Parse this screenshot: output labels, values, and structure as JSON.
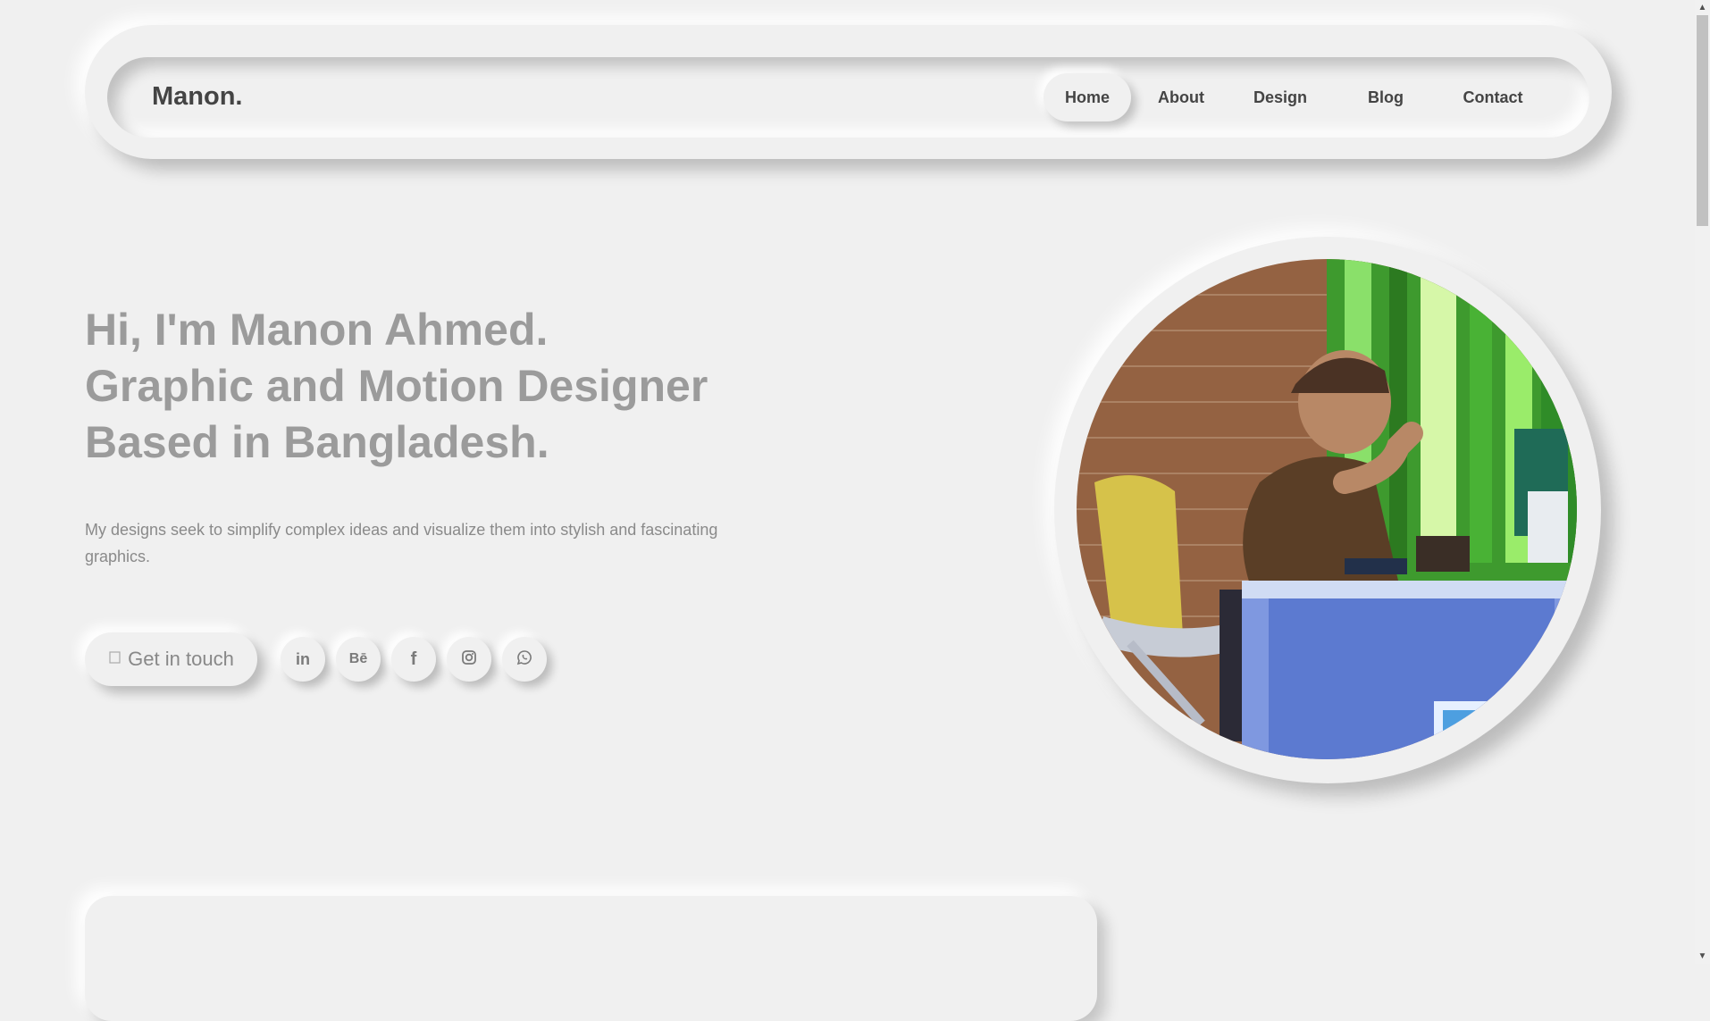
{
  "nav": {
    "logo": "Manon.",
    "links": [
      {
        "label": "Home",
        "active": true
      },
      {
        "label": "About",
        "active": false
      },
      {
        "label": "Design",
        "active": false
      },
      {
        "label": "Blog",
        "active": false
      },
      {
        "label": "Contact",
        "active": false
      }
    ]
  },
  "hero": {
    "title_lines": [
      "Hi, I'm Manon Ahmed.",
      "Graphic and Motion Designer",
      "Based in Bangladesh."
    ],
    "description": "My designs seek to simplify complex ideas and visualize them into stylish and fascinating graphics.",
    "cta_label": "Get in touch",
    "cta_icon": "paper-plane-icon"
  },
  "socials": [
    {
      "name": "linkedin-icon",
      "glyph": "in"
    },
    {
      "name": "behance-icon",
      "glyph": "Bē"
    },
    {
      "name": "facebook-icon",
      "glyph": "f"
    },
    {
      "name": "instagram-icon",
      "glyph": ""
    },
    {
      "name": "whatsapp-icon",
      "glyph": ""
    }
  ],
  "colors": {
    "background": "#f0f0f0",
    "heading": "#9b9b9b",
    "text": "#8a8a8a",
    "nav_text": "#444444"
  }
}
